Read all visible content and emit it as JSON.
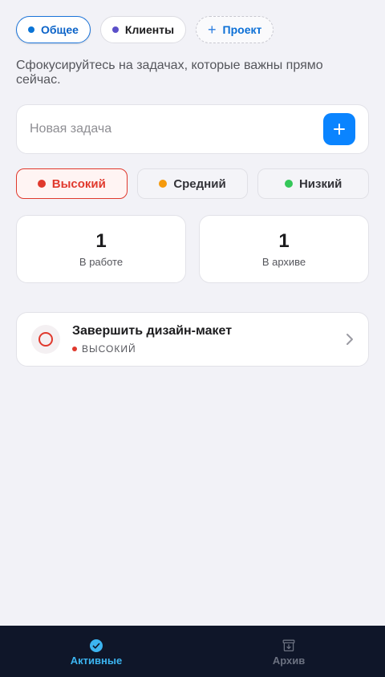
{
  "projects": [
    {
      "label": "Общее",
      "dot_color": "#0b74d6",
      "active": true
    },
    {
      "label": "Клиенты",
      "dot_color": "#5b4fc9",
      "active": false
    }
  ],
  "add_project_label": "Проект",
  "subtitle": "Сфокусируйтесь на задачах, которые важны прямо сейчас.",
  "new_task": {
    "placeholder": "Новая задача",
    "value": ""
  },
  "priorities": [
    {
      "label": "Высокий",
      "color": "#e0392d",
      "selected": true
    },
    {
      "label": "Средний",
      "color": "#f59a0c",
      "selected": false
    },
    {
      "label": "Низкий",
      "color": "#34c759",
      "selected": false
    }
  ],
  "stats": [
    {
      "value": "1",
      "label": "В работе"
    },
    {
      "value": "1",
      "label": "В архиве"
    }
  ],
  "tasks": [
    {
      "title": "Завершить дизайн-макет",
      "priority_tag": "ВЫСОКИЙ",
      "priority_color": "#e0392d"
    }
  ],
  "tabs": [
    {
      "label": "Активные",
      "icon": "check-circle-icon",
      "active": true
    },
    {
      "label": "Архив",
      "icon": "archive-box-icon",
      "active": false
    }
  ]
}
